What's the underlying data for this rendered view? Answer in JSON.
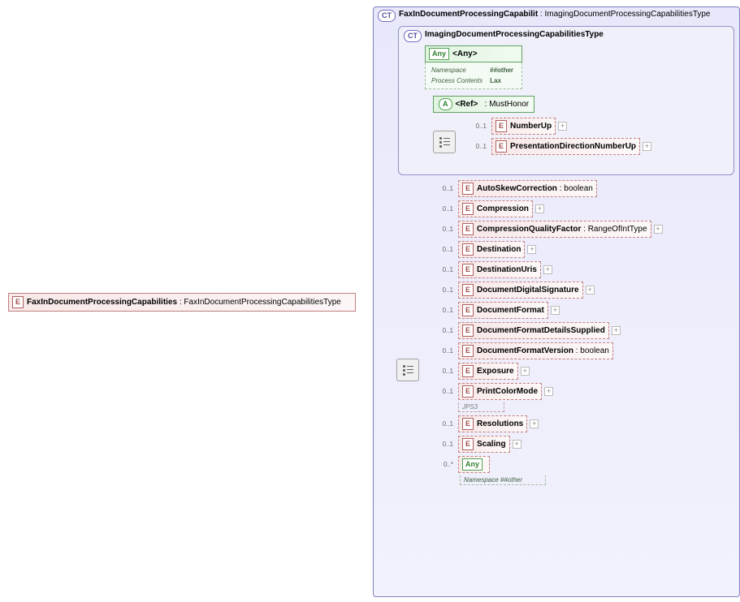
{
  "root": {
    "badge": "E",
    "name": "FaxInDocumentProcessingCapabilities",
    "type": "FaxInDocumentProcessingCapabilitiesType"
  },
  "mainCT": {
    "badge": "CT",
    "name": "FaxInDocumentProcessingCapabilit",
    "type": "ImagingDocumentProcessingCapabilitiesType"
  },
  "innerCT": {
    "badge": "CT",
    "name": "ImagingDocumentProcessingCapabilitiesType"
  },
  "anyBlock": {
    "badge": "Any",
    "label": "<Any>",
    "rows": [
      [
        "Namespace",
        "##other"
      ],
      [
        "Process Contents",
        "Lax"
      ]
    ]
  },
  "refBlock": {
    "badge": "A",
    "label": "<Ref>",
    "type": "MustHonor"
  },
  "innerChildren": [
    {
      "occ": "0..1",
      "name": "NumberUp",
      "expand": true
    },
    {
      "occ": "0..1",
      "name": "PresentationDirectionNumberUp",
      "expand": true
    }
  ],
  "outerChildren": [
    {
      "occ": "0..1",
      "name": "AutoSkewCorrection",
      "type": "boolean"
    },
    {
      "occ": "0..1",
      "name": "Compression",
      "expand": true
    },
    {
      "occ": "0..1",
      "name": "CompressionQualityFactor",
      "type": "RangeOfIntType",
      "expand": true
    },
    {
      "occ": "0..1",
      "name": "Destination",
      "expand": true
    },
    {
      "occ": "0..1",
      "name": "DestinationUris",
      "expand": true
    },
    {
      "occ": "0..1",
      "name": "DocumentDigitalSignature",
      "expand": true
    },
    {
      "occ": "0..1",
      "name": "DocumentFormat",
      "expand": true
    },
    {
      "occ": "0..1",
      "name": "DocumentFormatDetailsSupplied",
      "expand": true
    },
    {
      "occ": "0..1",
      "name": "DocumentFormatVersion",
      "type": "boolean"
    },
    {
      "occ": "0..1",
      "name": "Exposure",
      "expand": true
    },
    {
      "occ": "0..1",
      "name": "PrintColorMode",
      "expand": true,
      "note": "JPS3"
    },
    {
      "occ": "0..1",
      "name": "Resolutions",
      "expand": true
    },
    {
      "occ": "0..1",
      "name": "Scaling",
      "expand": true
    },
    {
      "occ": "0..*",
      "name": "<Any>",
      "isAny": true,
      "anyNote": "Namespace   ##other"
    }
  ]
}
